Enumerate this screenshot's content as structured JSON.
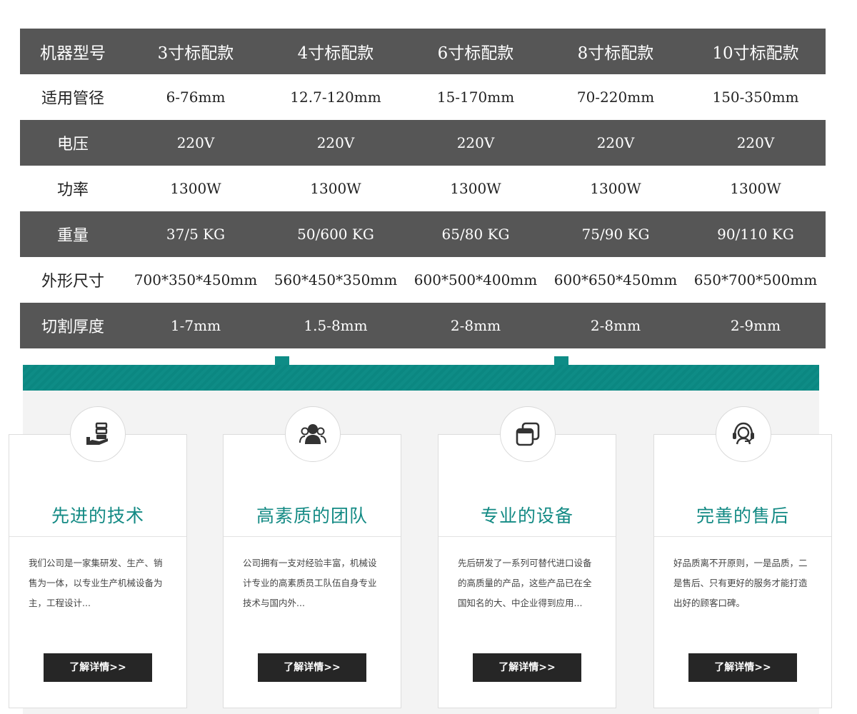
{
  "spec_table": {
    "header": [
      "机器型号",
      "3寸标配款",
      "4寸标配款",
      "6寸标配款",
      "8寸标配款",
      "10寸标配款"
    ],
    "rows": [
      [
        "适用管径",
        "6-76mm",
        "12.7-120mm",
        "15-170mm",
        "70-220mm",
        "150-350mm"
      ],
      [
        "电压",
        "220V",
        "220V",
        "220V",
        "220V",
        "220V"
      ],
      [
        "功率",
        "1300W",
        "1300W",
        "1300W",
        "1300W",
        "1300W"
      ],
      [
        "重量",
        "37/5 KG",
        "50/600 KG",
        "65/80 KG",
        "75/90 KG",
        "90/110 KG"
      ],
      [
        "外形尺寸",
        "700*350*450mm",
        "560*450*350mm",
        "600*500*400mm",
        "600*650*450mm",
        "650*700*500mm"
      ],
      [
        "切割厚度",
        "1-7mm",
        "1.5-8mm",
        "2-8mm",
        "2-8mm",
        "2-9mm"
      ]
    ]
  },
  "colors": {
    "table_dark_row": "#565656",
    "accent_teal": "#138a84",
    "button_bg": "#262626"
  },
  "features": [
    {
      "icon": "server-hand-icon",
      "title": "先进的技术",
      "description": "我们公司是一家集研发、生产、销售为一体，以专业生产机械设备为主，工程设计...",
      "button": "了解详情>>"
    },
    {
      "icon": "team-icon",
      "title": "高素质的团队",
      "description": "公司拥有一支对经验丰富，机械设计专业的高素质员工队伍自身专业技术与国内外...",
      "button": "了解详情>>"
    },
    {
      "icon": "equipment-icon",
      "title": "专业的设备",
      "description": "先后研发了一系列可替代进口设备的高质量的产品，这些产品已在全国知名的大、中企业得到应用...",
      "button": "了解详情>>"
    },
    {
      "icon": "headset-service-icon",
      "title": "完善的售后",
      "description": "好品质离不开原则，一是品质，二是售后、只有更好的服务才能打造出好的顾客口碑。",
      "button": "了解详情>>"
    }
  ]
}
